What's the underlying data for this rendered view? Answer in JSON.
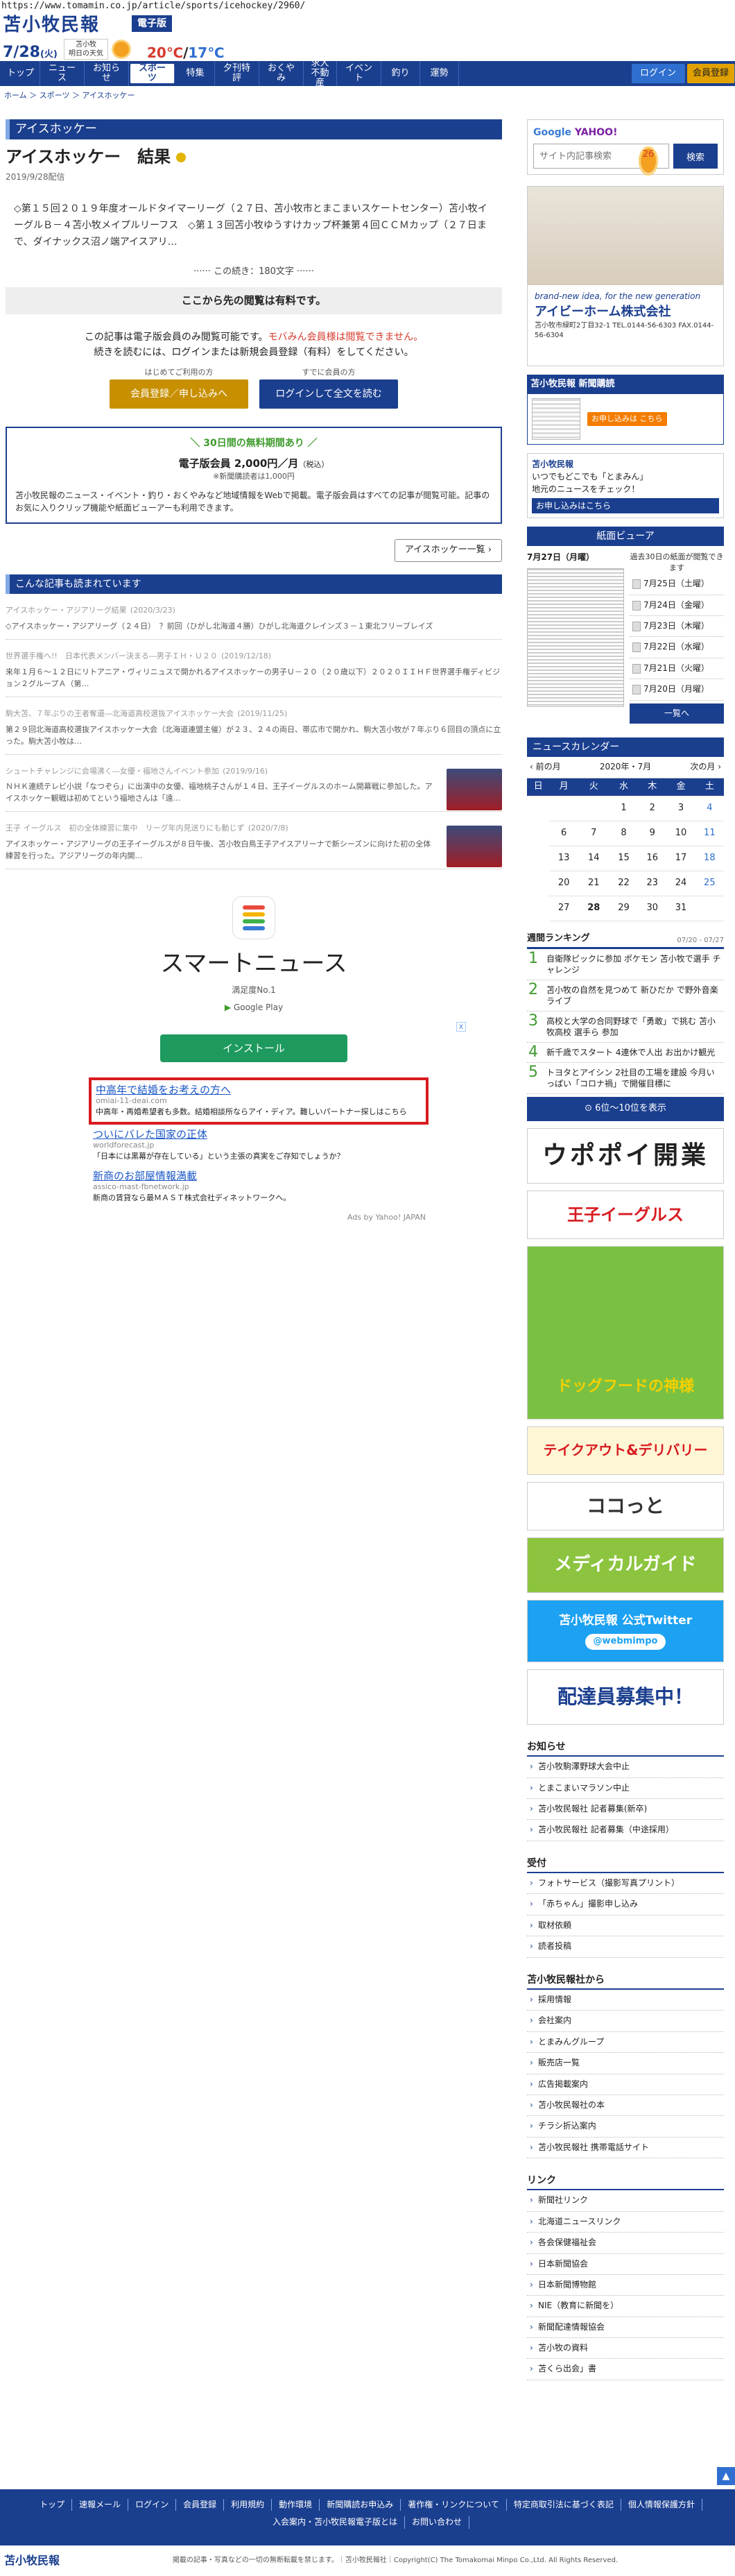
{
  "url": "https://www.tomamin.co.jp/article/sports/icehockey/2960/",
  "masthead": {
    "logo": "苫小牧民報",
    "edition": "電子版",
    "date": "7/28",
    "weekday": "(火)",
    "weather_line1": "苫小牧",
    "weather_line2": "明日の天気",
    "temp_hi": "20℃",
    "temp_sep": "/",
    "temp_lo": "17℃"
  },
  "nav": {
    "items": [
      "トップ",
      "ニュース",
      "お知らせ",
      "スポーツ",
      "特集",
      "夕刊特評",
      "おくやみ",
      "求人\n不動産",
      "イベント",
      "釣り",
      "運勢"
    ],
    "active": "スポーツ",
    "login": "ログイン",
    "signup": "会員登録"
  },
  "breadcrumb": "ホーム ＞ スポーツ ＞ アイスホッケー",
  "article": {
    "category": "アイスホッケー",
    "title": "アイスホッケー　結果",
    "date": "2019/9/28配信",
    "lead": "◇第１５回２０１９年度オールドタイマーリーグ（２７日、苫小牧市とまこまいスケートセンター）苫小牧イーグルＢ－４苫小牧メイプルリーフス　◇第１３回苫小牧ゆうすけカップ杯兼第４回ＣＣＭカップ（２７日まで、ダイナックス沼ノ端アイスアリ…",
    "count": "この続き：180文字"
  },
  "paywall": {
    "head": "ここから先の閲覧は有料です。",
    "line1a": "この記事は電子版会員のみ閲覧可能です。",
    "line1b": "モバみん会員様は閲覧できません。",
    "line2": "続きを読むには、ログインまたは新規会員登録（有料）をしてください。",
    "first": "はじめてご利用の方",
    "btn_signup": "会員登録／申し込みへ",
    "member": "すでに会員の方",
    "btn_login": "ログインして全文を読む"
  },
  "trial": {
    "head": "30日間の無料期間あり",
    "price": "電子版会員 2,000円／月",
    "tax": "（税込）",
    "sub": "※新聞購読者は1,000円",
    "body": "苫小牧民報のニュース・イベント・釣り・おくやみなど地域情報をWebで掲載。電子版会員はすべての記事が閲覧可能。記事のお気に入りクリップ機能や紙面ビューアーも利用できます。"
  },
  "more_btn": "アイスホッケー一覧",
  "also": {
    "heading": "こんな記事も読まれています",
    "items": [
      {
        "title": "アイスホッケー・アジアリーグ結果",
        "date": "(2020/3/23)",
        "body": "◇アイスホッケー・アジアリーグ（２４日）　？前回（ひがし北海道４勝）ひがし北海道クレインズ３－１東北フリーブレイズ"
      },
      {
        "title": "世界選手権へ!!　日本代表メンバー決まる―男子ＩＨ・Ｕ２０",
        "date": "(2019/12/18)",
        "body": "来年１月６～１２日にリトアニア・ヴィリニュスで開かれるアイスホッケーの男子Ｕ－２０（２０歳以下）２０２０ＩＩＨＦ世界選手権ディビジョン２グループＡ（第…"
      },
      {
        "title": "駒大苫、７年ぶりの王者奪還―北海道高校選抜アイスホッケー大会",
        "date": "(2019/11/25)",
        "body": "第２９回北海道高校選抜アイスホッケー大会（北海道連盟主催）が２３、２４の両日、帯広市で開かれ、駒大苫小牧が７年ぶり６回目の頂点に立った。駒大苫小牧は…"
      },
      {
        "title": "シュートチャレンジに会場沸く―女優・福地さんイベント参加",
        "date": "(2019/9/16)",
        "body": "ＮＨＫ連続テレビ小説「なつぞら」に出演中の女優、福地桃子さんが１４日、王子イーグルスのホーム開幕戦に参加した。アイスホッケー観戦は初めてという福地さんは「遠…"
      },
      {
        "title": "王子 イーグルス　初の全体練習に集中　リーグ年内見送りにも動じず",
        "date": "(2020/7/8)",
        "body": "アイスホッケー・アジアリーグの王子イーグルスが８日午後、苫小牧白鳥王子アイスアリーナで新シーズンに向けた初の全体練習を行った。アジアリーグの年内開…"
      }
    ]
  },
  "smart": {
    "title": "スマートニュース",
    "sub": "満足度No.1",
    "store": "Google Play",
    "install": "インストール",
    "adx": "X"
  },
  "ads": [
    {
      "title": "中高年で結婚をお考えの方へ",
      "url": "omiai-11-deai.com",
      "desc": "中高年・再婚希望者も多数。結婚相談所ならアイ・ディア。難しいパートナー探しはこちら"
    },
    {
      "title": "ついにバレた国家の正体",
      "url": "worldforecast.jp",
      "desc": "「日本には黒幕が存在している」という主張の真実をご存知でしょうか？"
    },
    {
      "title": "新商のお部屋情報満載",
      "url": "assico-mast-fbnetwork.jp",
      "desc": "新商の賃貸なら最ＭＡＳＴ株式会社ディネットワークへ。"
    }
  ],
  "ad_credit": "Ads by Yahoo! JAPAN",
  "side": {
    "search_brand_g": "Google",
    "search_brand_y": "YAHOO!",
    "search_placeholder": "サイト内記事検索",
    "search_btn": "検索",
    "house_caption": "brand-new idea, for the new generation",
    "house_company": "アイビーホーム株式会社",
    "house_tel": "苫小牧市緑町2丁目32-1 TEL.0144-56-6303 FAX.0144-56-6304",
    "ep_title": "苫小牧民報 新聞購読",
    "ep_chip": "お申し込みは こちら",
    "ep2_title": "苫小牧民報",
    "ep2_text": "いつでもどこでも「とまみん」\n地元のニュースをチェック！",
    "ep2_bar": "お申し込みはこちら",
    "viewer_head": "紙面ビューア",
    "viewer_date": "7月27日（月曜）",
    "past": "過去30日の紙面が閲覧できます",
    "past_days": [
      "7月25日（土曜）",
      "7月24日（金曜）",
      "7月23日（木曜）",
      "7月22日（水曜）",
      "7月21日（火曜）",
      "7月20日（月曜）"
    ],
    "past_btn": "一覧へ",
    "cal_head": "ニュースカレンダー",
    "cal_prev": "‹ 前の月",
    "cal_title": "2020年・7月",
    "cal_next": "次の月 ›",
    "cal_days": [
      "日",
      "月",
      "火",
      "水",
      "木",
      "金",
      "土"
    ],
    "cal_rows": [
      [
        "",
        "",
        "",
        "1",
        "2",
        "3",
        "4"
      ],
      [
        "5",
        "6",
        "7",
        "8",
        "9",
        "10",
        "11"
      ],
      [
        "12",
        "13",
        "14",
        "15",
        "16",
        "17",
        "18"
      ],
      [
        "19",
        "20",
        "21",
        "22",
        "23",
        "24",
        "25"
      ],
      [
        "26",
        "27",
        "28",
        "29",
        "30",
        "31",
        ""
      ]
    ],
    "rank_head": "週間ランキング",
    "rank_range": "07/20 - 07/27",
    "rank": [
      "自衛隊ピックに参加 ポケモン 苫小牧で選手 チャレンジ",
      "苫小牧の自然を見つめて 新ひだか で野外音楽ライブ",
      "高校と大学の合同野球で「勇敢」で挑む 苫小牧高校 選手ら 参加",
      "新千歳でスタート 4連休で人出 お出かけ観光",
      "トヨタとアイシン 2社目の工場を建設 今月いっぱい「コロナ禍」で開催目標に"
    ],
    "rank_more": "6位～10位を表示",
    "b1": "ウポポイ開業",
    "b2": "王子イーグルス",
    "b3": "ドッグフードの神様",
    "b4": "テイクアウト&デリバリー",
    "b5": "ココっと",
    "b6": "メディカルガイド",
    "b7": "苫小牧民報 公式Twitter",
    "b7b": "@webmimpo",
    "b8": "配達員募集中！",
    "sec1": "お知らせ",
    "sec1_items": [
      "苫小牧駒澤野球大会中止",
      "とまこまいマラソン中止",
      "苫小牧民報社 記者募集(新卒)",
      "苫小牧民報社 記者募集（中途採用）"
    ],
    "sec2": "受付",
    "sec2_items": [
      "フォトサービス（撮影写真プリント）",
      "「赤ちゃん」撮影申し込み",
      "取材依頼",
      "読者投稿"
    ],
    "sec3": "苫小牧民報社から",
    "sec3_items": [
      "採用情報",
      "会社案内",
      "とまみんグループ",
      "販売店一覧",
      "広告掲載案内",
      "苫小牧民報社の本",
      "チラシ折込案内",
      "苫小牧民報社 携帯電話サイト"
    ],
    "sec4": "リンク",
    "sec4_items": [
      "新聞社リンク",
      "北海道ニュースリンク",
      "各会保健福祉会",
      "日本新聞協会",
      "日本新聞博物館",
      "NIE（教育に新聞を）",
      "新聞配達情報協会",
      "苫小牧の資料",
      "苫くら出会」書"
    ]
  },
  "footer": {
    "links": [
      "トップ",
      "速報メール",
      "ログイン",
      "会員登録",
      "利用規約",
      "動作環境",
      "新聞購読お申込み",
      "著作権・リンクについて",
      "特定商取引法に基づく表記",
      "個人情報保護方針",
      "入会案内・苫小牧民報電子版とは",
      "お問い合わせ"
    ],
    "logo": "苫小牧民報",
    "copy": "掲載の記事・写真などの一切の無断転載を禁じます。｜苫小牧民報社｜Copyright(C) The Tomakomai Minpo Co.,Ltd. All Rights Reserved.",
    "pagetop": "▲"
  },
  "colors": {
    "navy": "#1b3f8f",
    "gold": "#c89000",
    "red": "#d81b20",
    "green": "#1e9a5e"
  }
}
